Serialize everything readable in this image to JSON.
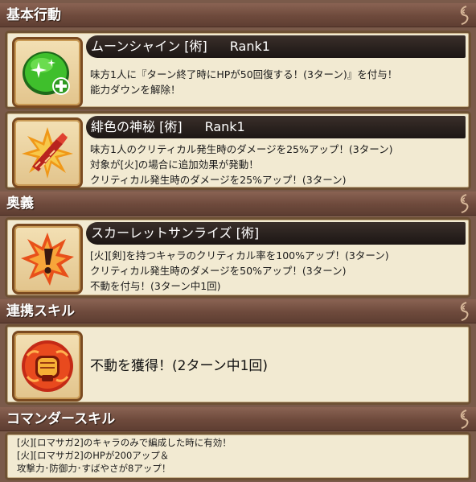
{
  "sections": {
    "basic": "基本行動",
    "ougi": "奥義",
    "renkei": "連携スキル",
    "commander": "コマンダースキル"
  },
  "skills": [
    {
      "icon": "green-sparkle-heal-icon",
      "title": "ムーンシャイン [術]",
      "rank": "Rank1",
      "lines": [
        "味方1人に『ターン終了時にHPが50回復する！(3ターン)』を付与！",
        "能力ダウンを解除！"
      ]
    },
    {
      "icon": "crimson-feather-sword-icon",
      "title": "緋色の神秘 [術]",
      "rank": "Rank1",
      "lines": [
        "味方1人のクリティカル発生時のダメージを25%アップ！(3ターン)",
        "対象が[火]の場合に追加効果が発動！",
        "クリティカル発生時のダメージを25%アップ！(3ターン)"
      ]
    }
  ],
  "ougi": {
    "icon": "exclamation-burst-icon",
    "title": "スカーレットサンライズ [術]",
    "lines": [
      "[火][剣]を持つキャラのクリティカル率を100%アップ！(3ターン)",
      "クリティカル発生時のダメージを50%アップ！(3ターン)",
      "不動を付与！(3ターン中1回)"
    ]
  },
  "renkei": {
    "icon": "fist-emblem-icon",
    "text": "不動を獲得！(2ターン中1回)"
  },
  "commander": {
    "lines": [
      "[火][ロマサガ2]のキャラのみで編成した時に有効！",
      "[火][ロマサガ2]のHPが200アップ＆",
      "攻撃力･防御力･すばやさが8アップ！"
    ]
  }
}
